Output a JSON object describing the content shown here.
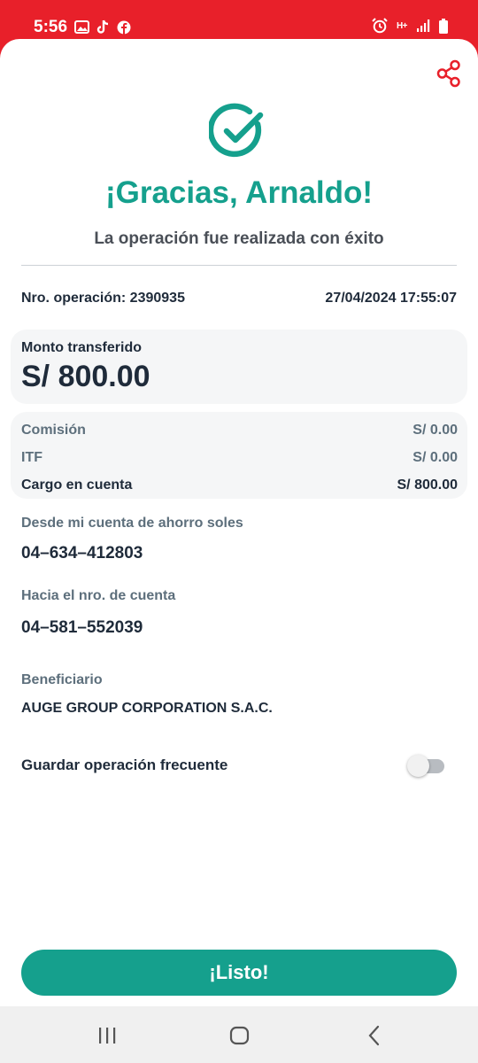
{
  "status_bar": {
    "time": "5:56",
    "left_icons": [
      "gallery-icon",
      "tiktok-icon",
      "facebook-icon"
    ],
    "right_icons": [
      "alarm-icon",
      "network-hplus-icon",
      "signal-icon",
      "battery-icon"
    ],
    "network_label": "H+"
  },
  "header": {
    "share_icon": "share-icon",
    "success_icon": "check-circle-icon",
    "title": "¡Gracias, Arnaldo!",
    "subtitle": "La operación fue realizada con éxito"
  },
  "operation": {
    "number_text": "Nro. operación: 2390935",
    "datetime": "27/04/2024 17:55:07"
  },
  "amount": {
    "label": "Monto transferido",
    "value": "S/ 800.00"
  },
  "fees": [
    {
      "label": "Comisión",
      "value": "S/ 0.00"
    },
    {
      "label": "ITF",
      "value": "S/ 0.00"
    },
    {
      "label": "Cargo en cuenta",
      "value": "S/ 800.00"
    }
  ],
  "details": {
    "from_label": "Desde mi cuenta de ahorro soles",
    "from_value": "04–634–412803",
    "to_label": "Hacia el nro. de cuenta",
    "to_value": "04–581–552039",
    "beneficiary_label": "Beneficiario",
    "beneficiary_value": "AUGE GROUP CORPORATION S.A.C."
  },
  "favorite": {
    "label": "Guardar operación frecuente",
    "enabled": false
  },
  "actions": {
    "done_label": "¡Listo!"
  },
  "colors": {
    "brand_red": "#e8202a",
    "accent_teal": "#15a08d"
  },
  "nav_bar": {
    "icons": [
      "recent-apps-icon",
      "home-icon",
      "back-icon"
    ]
  }
}
